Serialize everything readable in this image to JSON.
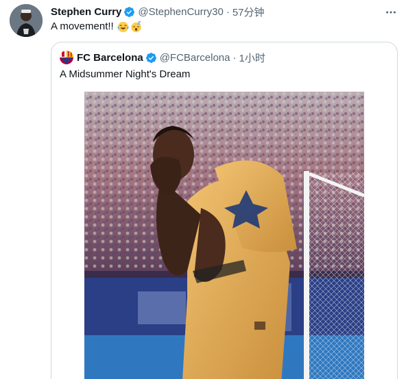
{
  "tweet": {
    "author_name": "Stephen Curry",
    "handle": "@StephenCurry30",
    "separator": "·",
    "time": "57分钟",
    "text": "A movement!!",
    "emojis": [
      "joy-emoji",
      "sleeping-emoji"
    ],
    "more_icon": "more-horizontal-icon",
    "verified_icon": "verified-badge-icon"
  },
  "quote": {
    "author_name": "FC Barcelona",
    "handle": "@FCBarcelona",
    "separator": "·",
    "time": "1小时",
    "text": "A Midsummer Night's Dream",
    "verified_icon": "verified-badge-icon",
    "photo": "player-celebration-photo"
  },
  "colors": {
    "verified": "#1d9bf0",
    "secondary_text": "#536471",
    "border": "#cfd9de",
    "jersey": "#e7b45a"
  }
}
